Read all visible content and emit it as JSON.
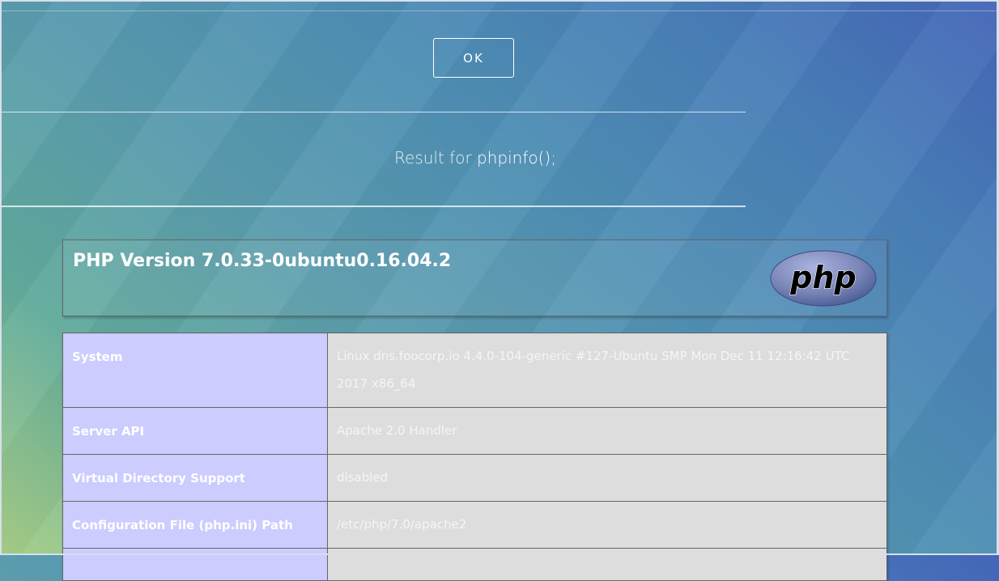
{
  "dialog": {
    "ok_label": "OK"
  },
  "result": {
    "prefix": "Result for",
    "function": "phpinfo();"
  },
  "phpinfo": {
    "version_title": "PHP Version 7.0.33-0ubuntu0.16.04.2",
    "logo_text": "php",
    "rows": [
      {
        "key": "System",
        "value": "Linux dns.foocorp.io 4.4.0-104-generic #127-Ubuntu SMP Mon Dec 11 12:16:42 UTC 2017 x86_64"
      },
      {
        "key": "Server API",
        "value": "Apache 2.0 Handler"
      },
      {
        "key": "Virtual Directory Support",
        "value": "disabled"
      },
      {
        "key": "Configuration File (php.ini) Path",
        "value": "/etc/php/7.0/apache2"
      },
      {
        "key": "",
        "value": ""
      }
    ]
  },
  "colors": {
    "key_cell_bg": "#ccccff",
    "value_cell_bg": "#dddddd",
    "logo_fill": "#7a86b8"
  }
}
